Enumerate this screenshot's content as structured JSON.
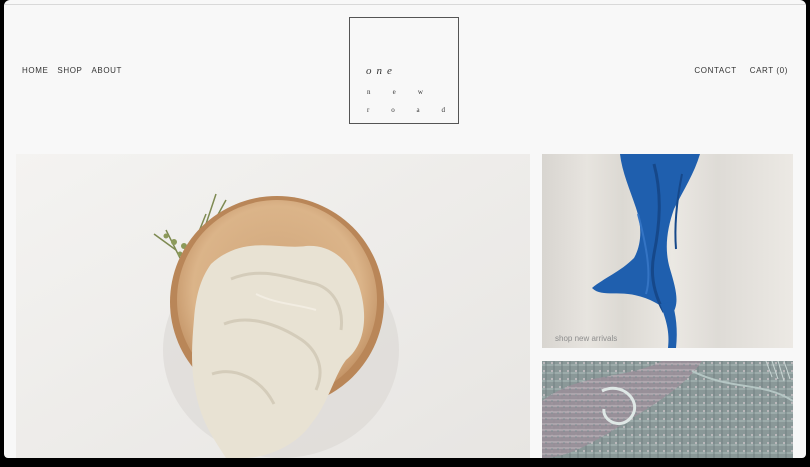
{
  "nav": {
    "left": [
      "HOME",
      "SHOP",
      "ABOUT"
    ],
    "right": [
      "CONTACT",
      "CART (0)"
    ]
  },
  "logo": {
    "line1": "one",
    "line2": [
      "n",
      "e",
      "w"
    ],
    "line3": [
      "r",
      "o",
      "a",
      "d"
    ]
  },
  "tiles": {
    "new_arrivals_caption": "shop new arrivals"
  },
  "colors": {
    "page_bg": "#f8f8f8",
    "nav_text": "#333333",
    "scarf_blue": "#1f5fae",
    "bowl_wood": "#d6ad7f",
    "cloth_cream": "#e9e3d5"
  }
}
